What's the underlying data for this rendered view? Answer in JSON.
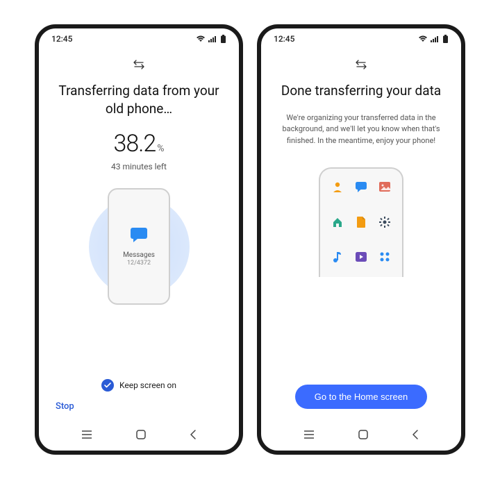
{
  "statusbar": {
    "time": "12:45"
  },
  "left": {
    "title": "Transferring data from your old phone…",
    "percent_num": "38.2",
    "percent_sym": "%",
    "time_left": "43 minutes left",
    "item_label": "Messages",
    "item_count": "12/4372",
    "keep_screen": "Keep screen on",
    "stop": "Stop"
  },
  "right": {
    "title": "Done transferring your data",
    "subtitle": "We're organizing your transferred data in the background, and we'll let you know when that's finished. In the meantime, enjoy your phone!",
    "cta": "Go to the Home screen"
  }
}
